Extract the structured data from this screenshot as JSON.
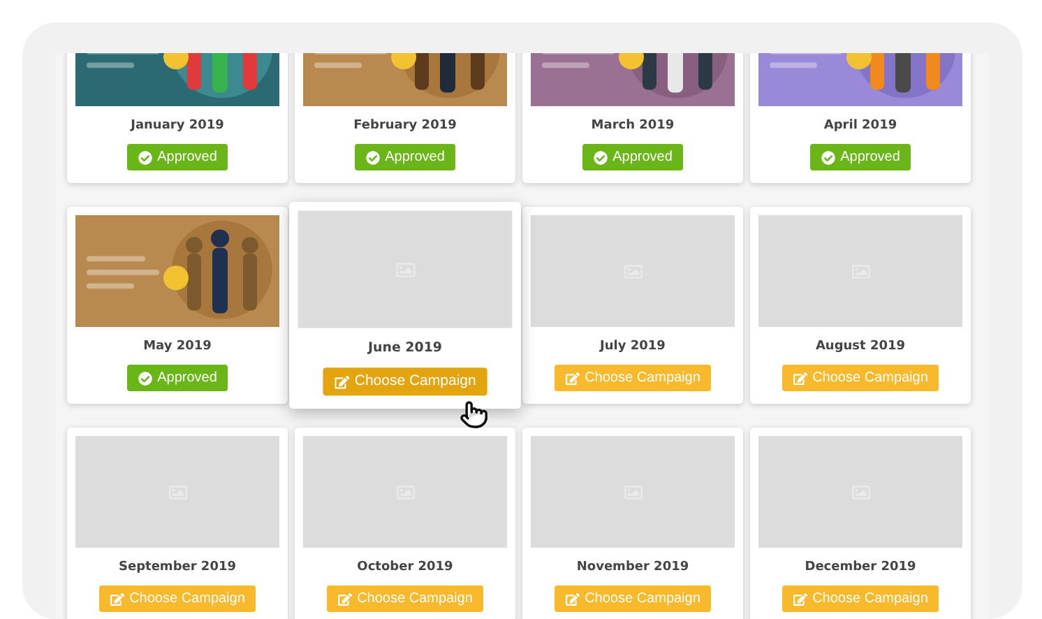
{
  "cards": [
    {
      "month": "January 2019",
      "status": {
        "kind": "approved",
        "label": "Approved"
      },
      "hovered": false
    },
    {
      "month": "February 2019",
      "status": {
        "kind": "approved",
        "label": "Approved"
      },
      "hovered": false
    },
    {
      "month": "March 2019",
      "status": {
        "kind": "approved",
        "label": "Approved"
      },
      "hovered": false
    },
    {
      "month": "April 2019",
      "status": {
        "kind": "approved",
        "label": "Approved"
      },
      "hovered": false
    },
    {
      "month": "May 2019",
      "status": {
        "kind": "approved",
        "label": "Approved"
      },
      "hovered": false
    },
    {
      "month": "June 2019",
      "thumbnail": {
        "kind": "placeholder"
      },
      "status": {
        "kind": "choose",
        "label": "Choose Campaign"
      },
      "hovered": true
    },
    {
      "month": "July 2019",
      "thumbnail": {
        "kind": "placeholder"
      },
      "status": {
        "kind": "choose",
        "label": "Choose Campaign"
      },
      "hovered": false
    },
    {
      "month": "August 2019",
      "thumbnail": {
        "kind": "placeholder"
      },
      "status": {
        "kind": "choose",
        "label": "Choose Campaign"
      },
      "hovered": false
    },
    {
      "month": "September 2019",
      "thumbnail": {
        "kind": "placeholder"
      },
      "status": {
        "kind": "choose",
        "label": "Choose Campaign"
      },
      "hovered": false
    },
    {
      "month": "October 2019",
      "thumbnail": {
        "kind": "placeholder"
      },
      "status": {
        "kind": "choose",
        "label": "Choose Campaign"
      },
      "hovered": false
    },
    {
      "month": "November 2019",
      "thumbnail": {
        "kind": "placeholder"
      },
      "status": {
        "kind": "choose",
        "label": "Choose Campaign"
      },
      "hovered": false
    },
    {
      "month": "December 2019",
      "thumbnail": {
        "kind": "placeholder"
      },
      "status": {
        "kind": "choose",
        "label": "Choose Campaign"
      },
      "hovered": false
    }
  ]
}
